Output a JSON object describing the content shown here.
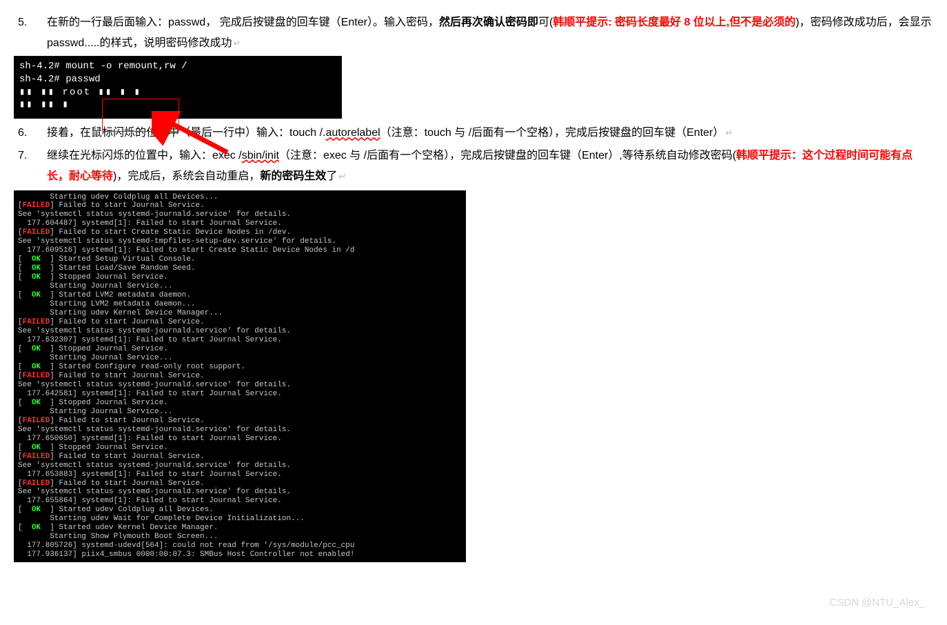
{
  "list": {
    "i5": {
      "num": "5.",
      "t1": "在新的一行最后面输入：passwd，  完成后按键盘的回车键（Enter）。输入密码，",
      "t2": "然后再次确认密码即",
      "t3": "可(",
      "t4": "韩顺平提示: 密码长度最好 8 位以上,但不是必须的",
      "t5": ")，密码修改成功后，会显示 passwd.....的样式，说明密码修改成功",
      "ret": "↵"
    },
    "i6": {
      "num": "6.",
      "t1": "接着，在鼠标闪烁的位置中（最后一行中）输入：touch /.",
      "u1": "autorelabel",
      "t2": "（注意：touch 与 /后面有一个空格），完成后按键盘的回车键（Enter）",
      "ret": "↵"
    },
    "i7": {
      "num": "7.",
      "t1": "继续在光标闪烁的位置中，输入：exec /",
      "u1": "sbin/init",
      "t2": "（注意：exec 与 /后面有一个空格），完成后按键盘的回车键（Enter）,等待系统自动修改密码(",
      "t3": "韩顺平提示：这个过程时间可能有点长，耐心等待",
      "t4": ")，完成后，系统会自动重启，",
      "t5": "新的密码生效",
      "t6": "了",
      "ret": "↵"
    }
  },
  "term1": {
    "l1": "sh-4.2# mount -o remount,rw /",
    "l2": "sh-4.2# passwd",
    "l3": "▮▮ ▮▮  root ▮▮ ▮ ▮",
    "l4": "▮▮  ▮▮ ▮"
  },
  "term2_lines": [
    {
      "pre": "       ",
      "t": "Starting udev Coldplug all Devices..."
    },
    {
      "st": "FAILED",
      "t": "Failed to start Journal Service."
    },
    {
      "pre": "",
      "t": "See 'systemctl status systemd-journald.service' for details."
    },
    {
      "pre": "  ",
      "t": "177.604487] systemd[1]: Failed to start Journal Service."
    },
    {
      "st": "FAILED",
      "t": "Failed to start Create Static Device Nodes in /dev."
    },
    {
      "pre": "",
      "t": "See 'systemctl status systemd-tmpfiles-setup-dev.service' for details."
    },
    {
      "pre": "  ",
      "t": "177.609516] systemd[1]: Failed to start Create Static Device Nodes in /d"
    },
    {
      "st": "OK",
      "t": "Started Setup Virtual Console."
    },
    {
      "st": "OK",
      "t": "Started Load/Save Random Seed."
    },
    {
      "st": "OK",
      "t": "Stopped Journal Service."
    },
    {
      "pre": "       ",
      "t": "Starting Journal Service..."
    },
    {
      "st": "OK",
      "t": "Started LVM2 metadata daemon."
    },
    {
      "pre": "       ",
      "t": "Starting LVM2 metadata daemon..."
    },
    {
      "pre": "       ",
      "t": "Starting udev Kernel Device Manager..."
    },
    {
      "st": "FAILED",
      "t": "Failed to start Journal Service."
    },
    {
      "pre": "",
      "t": "See 'systemctl status systemd-journald.service' for details."
    },
    {
      "pre": "  ",
      "t": "177.632307] systemd[1]: Failed to start Journal Service."
    },
    {
      "st": "OK",
      "t": "Stopped Journal Service."
    },
    {
      "pre": "       ",
      "t": "Starting Journal Service..."
    },
    {
      "st": "OK",
      "t": "Started Configure read-only root support."
    },
    {
      "st": "FAILED",
      "t": "Failed to start Journal Service."
    },
    {
      "pre": "",
      "t": "See 'systemctl status systemd-journald.service' for details."
    },
    {
      "pre": "  ",
      "t": "177.642581] systemd[1]: Failed to start Journal Service."
    },
    {
      "st": "OK",
      "t": "Stopped Journal Service."
    },
    {
      "pre": "       ",
      "t": "Starting Journal Service..."
    },
    {
      "st": "FAILED",
      "t": "Failed to start Journal Service."
    },
    {
      "pre": "",
      "t": "See 'systemctl status systemd-journald.service' for details."
    },
    {
      "pre": "  ",
      "t": "177.650650] systemd[1]: Failed to start Journal Service."
    },
    {
      "st": "OK",
      "t": "Stopped Journal Service."
    },
    {
      "st": "FAILED",
      "t": "Failed to start Journal Service."
    },
    {
      "pre": "",
      "t": "See 'systemctl status systemd-journald.service' for details."
    },
    {
      "pre": "  ",
      "t": "177.653883] systemd[1]: Failed to start Journal Service."
    },
    {
      "st": "FAILED",
      "t": "Failed to start Journal Service."
    },
    {
      "pre": "",
      "t": "See 'systemctl status systemd-journald.service' for details."
    },
    {
      "pre": "  ",
      "t": "177.655864] systemd[1]: Failed to start Journal Service."
    },
    {
      "st": "OK",
      "t": "Started udev Coldplug all Devices."
    },
    {
      "pre": "       ",
      "t": "Starting udev Wait for Complete Device Initialization..."
    },
    {
      "st": "OK",
      "t": "Started udev Kernel Device Manager."
    },
    {
      "pre": "       ",
      "t": "Starting Show Plymouth Boot Screen..."
    },
    {
      "pre": "  ",
      "t": "177.805726] systemd-udevd[564]: could not read from '/sys/module/pcc_cpu"
    },
    {
      "pre": "  ",
      "t": "177.936137] piix4_smbus 0000:00:07.3: SMBus Host Controller not enabled!"
    }
  ],
  "watermark": "CSDN @NTU_Alex_"
}
